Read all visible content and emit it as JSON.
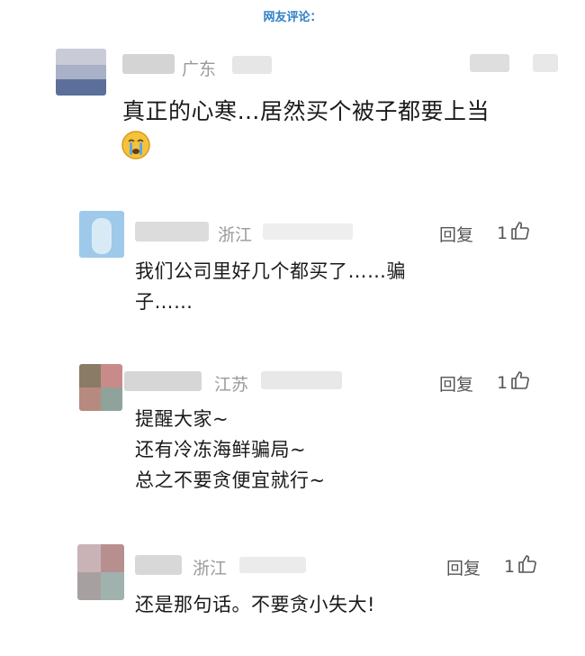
{
  "heading": "网友评论：",
  "comments": [
    {
      "location": "广东",
      "text": "真正的心寒…居然买个被子都要上当",
      "emoji": "crying-face-icon"
    },
    {
      "location": "浙江",
      "reply_label": "回复",
      "likes": "1",
      "text_lines": [
        "我们公司里好几个都买了……骗",
        "子……"
      ]
    },
    {
      "location": "江苏",
      "reply_label": "回复",
      "likes": "1",
      "text_lines": [
        "提醒大家~",
        "还有冷冻海鲜骗局~",
        "总之不要贪便宜就行~"
      ]
    },
    {
      "location": "浙江",
      "reply_label": "回复",
      "likes": "1",
      "text_lines": [
        "还是那句话。不要贪小失大!"
      ]
    }
  ],
  "colors": {
    "heading": "#2f7fc6",
    "meta_gray": "#9a9a9a"
  }
}
